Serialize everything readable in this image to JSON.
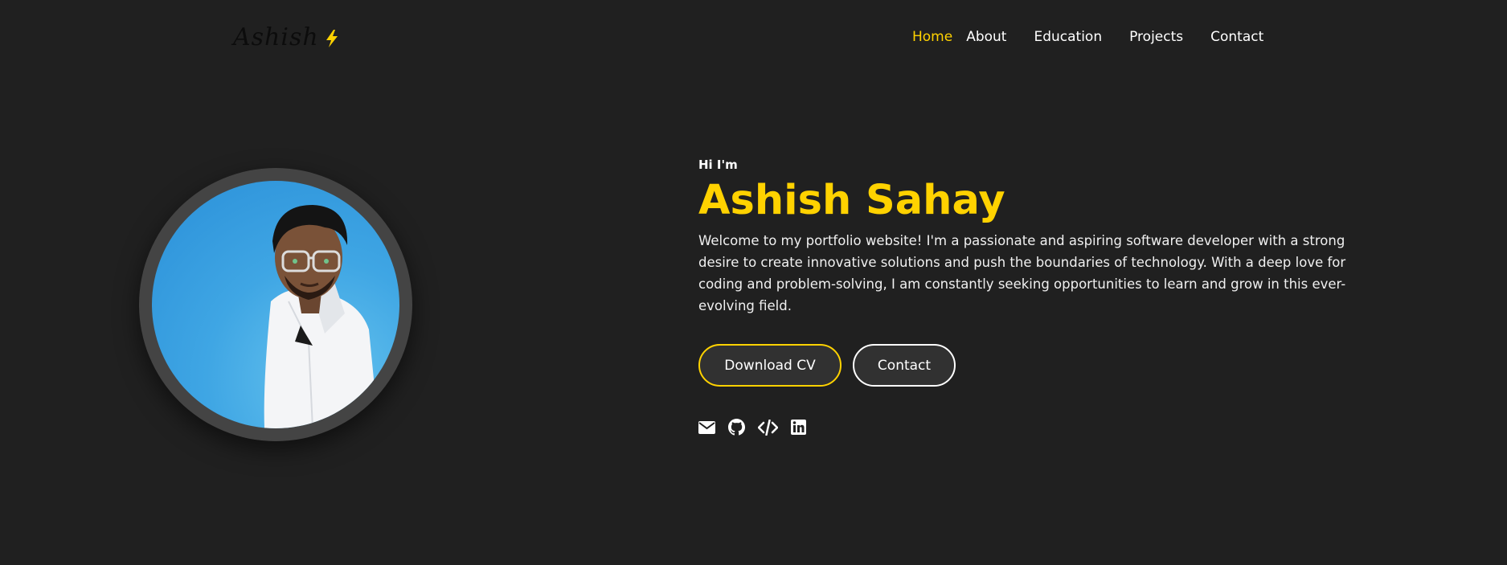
{
  "header": {
    "logo_text": "Ashish",
    "nav": [
      {
        "label": "Home",
        "active": true
      },
      {
        "label": "About",
        "active": false
      },
      {
        "label": "Education",
        "active": false
      },
      {
        "label": "Projects",
        "active": false
      },
      {
        "label": "Contact",
        "active": false
      }
    ]
  },
  "hero": {
    "greeting": "Hi I'm",
    "name": "Ashish Sahay",
    "description": "Welcome to my portfolio website! I'm a passionate and aspiring software developer with a strong desire to create innovative solutions and push the boundaries of technology. With a deep love for coding and problem-solving, I am constantly seeking opportunities to learn and grow in this ever-evolving field.",
    "buttons": {
      "download_cv": "Download CV",
      "contact": "Contact"
    },
    "socials": [
      "envelope-icon",
      "github-icon",
      "code-icon",
      "linkedin-icon"
    ]
  },
  "colors": {
    "background": "#202020",
    "accent": "#ffd200",
    "button_bg": "#313131",
    "avatar_ring": "#444444"
  }
}
